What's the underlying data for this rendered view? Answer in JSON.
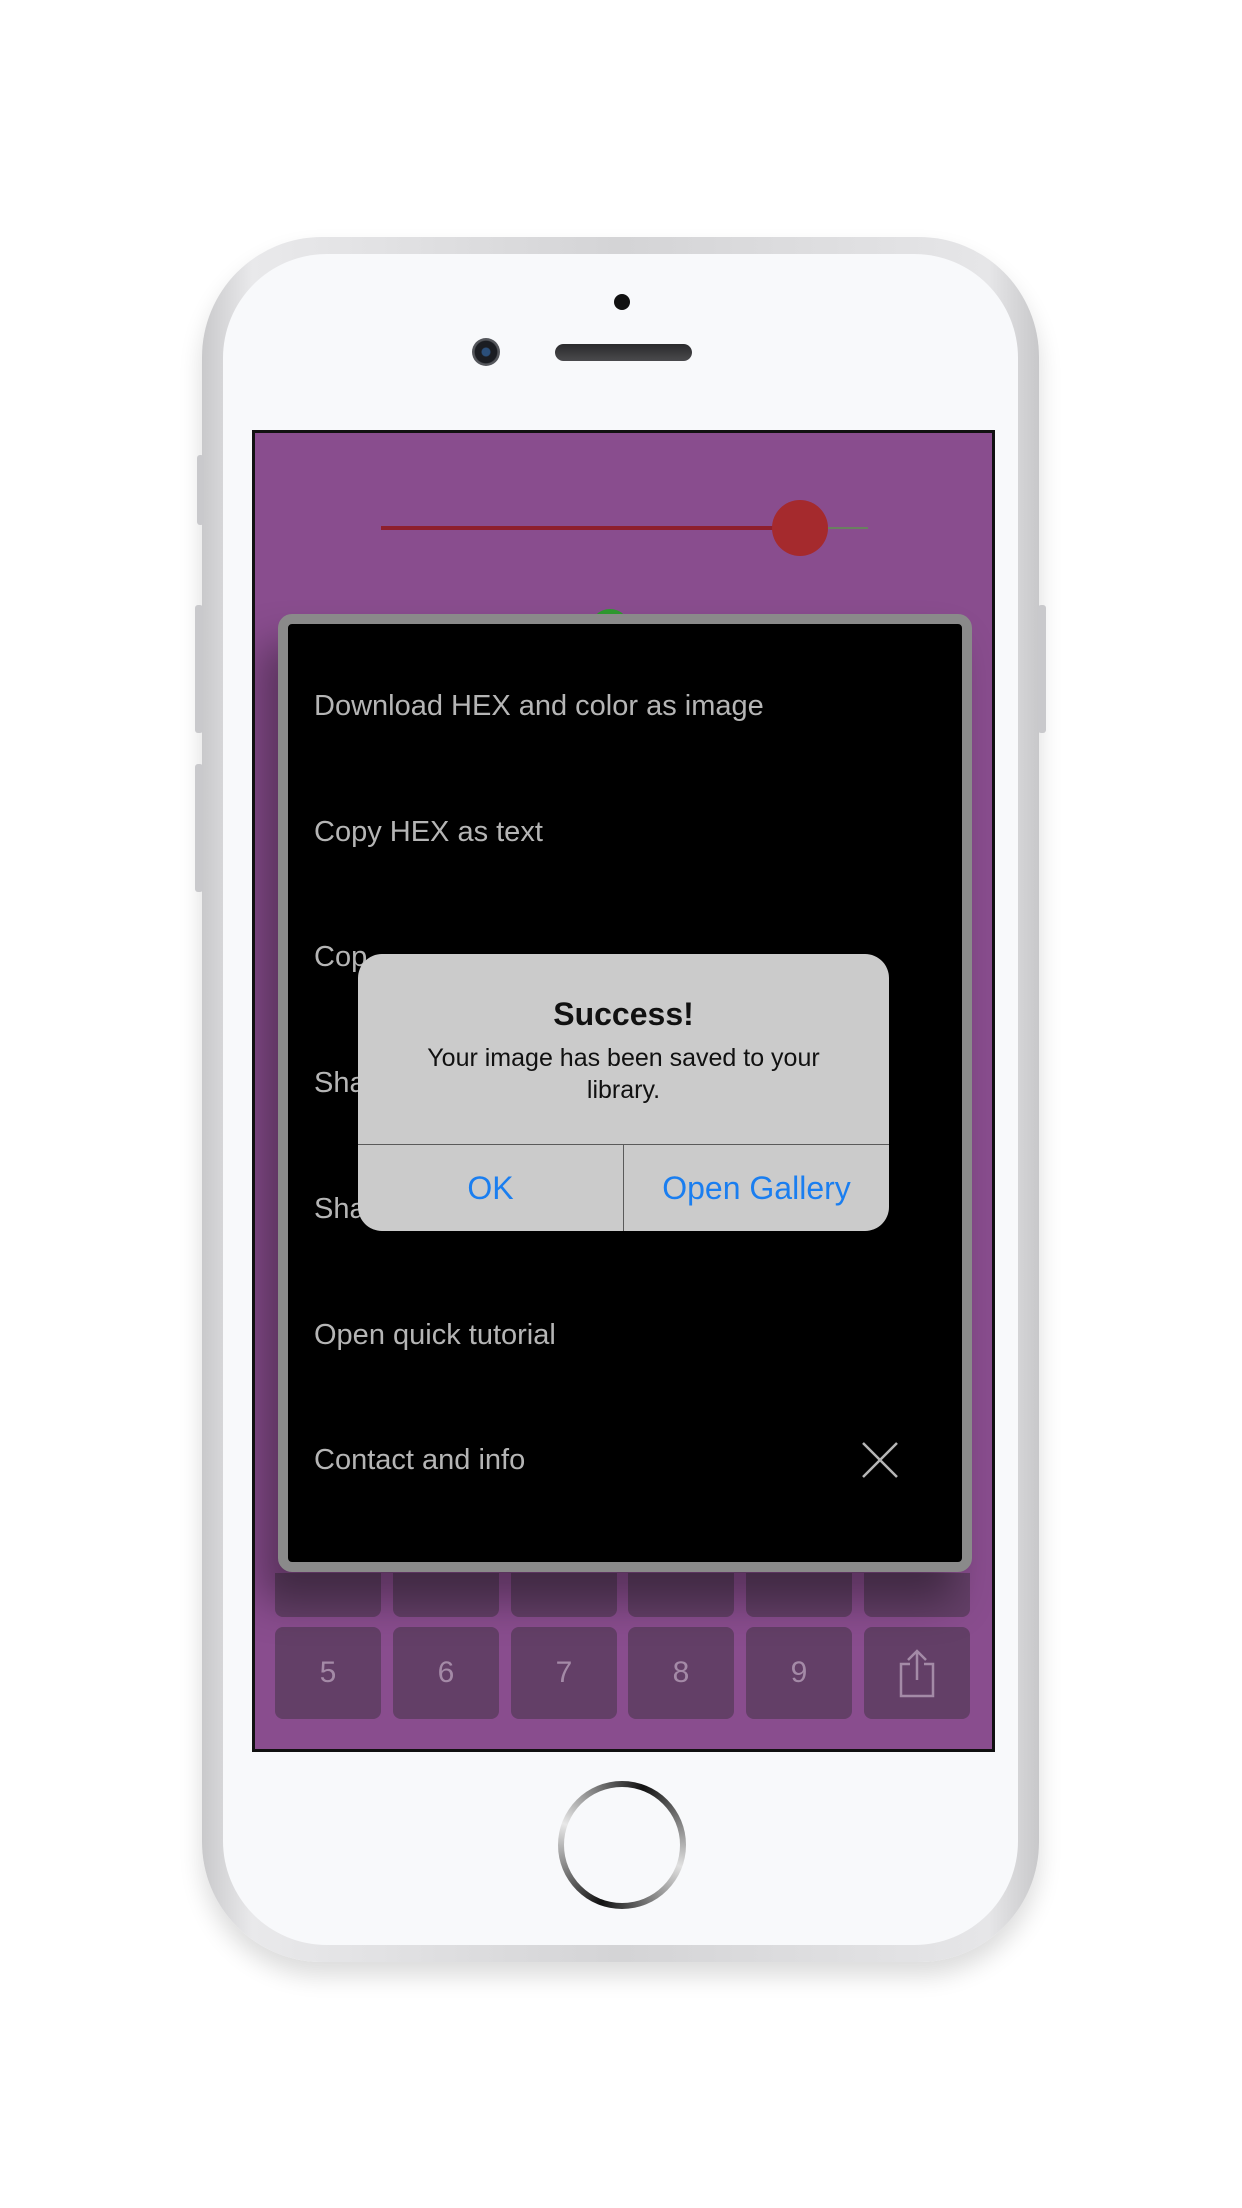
{
  "menu": {
    "items": [
      "Download HEX and color as image",
      "Copy HEX as text",
      "Cop",
      "Sha",
      "Sha",
      "Open quick tutorial",
      "Contact and info"
    ],
    "close_icon": "close-x-icon"
  },
  "alert": {
    "title": "Success!",
    "message": "Your image has been saved to your library.",
    "ok_label": "OK",
    "gallery_label": "Open Gallery"
  },
  "keypad": {
    "bottom_row": [
      "5",
      "6",
      "7",
      "8",
      "9"
    ],
    "share_icon": "share-icon"
  },
  "slider": {
    "value": 0.88,
    "color": "#a52a2d"
  },
  "colors": {
    "background": "#894d8e",
    "link": "#1a7ef0"
  }
}
